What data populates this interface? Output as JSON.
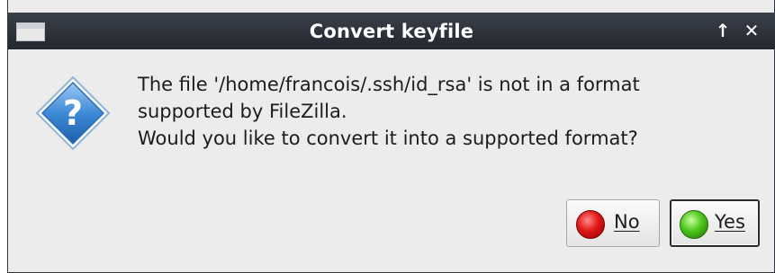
{
  "dialog": {
    "title": "Convert keyfile",
    "title_buttons": {
      "maximize_glyph": "↑",
      "close_glyph": "✕"
    },
    "icon": "question-icon",
    "message_lines": [
      "The file '/home/francois/.ssh/id_rsa' is not in a format",
      "supported by FileZilla.",
      "Would you like to convert it into a supported format?"
    ],
    "buttons": {
      "no": {
        "label": "No",
        "icon": "red-circle-icon"
      },
      "yes": {
        "label": "Yes",
        "icon": "green-circle-icon",
        "default": true
      }
    }
  },
  "colors": {
    "titlebar": "#2b3038",
    "dialog_bg": "#ececec",
    "icon_blue": "#3e8ad6",
    "no_red": "#e01616",
    "yes_green": "#4cc61a"
  }
}
